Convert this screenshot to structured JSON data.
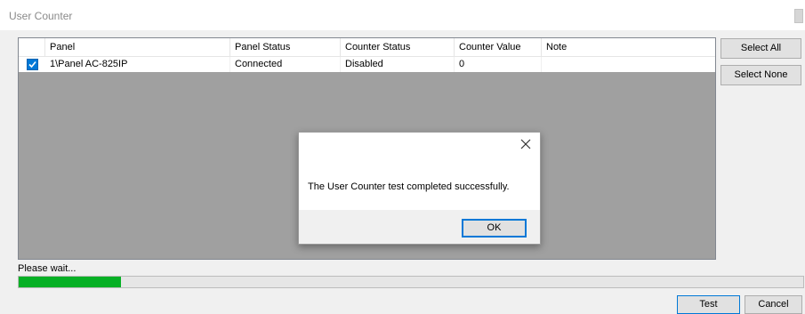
{
  "window": {
    "title": "User Counter"
  },
  "table": {
    "columns": [
      "Panel",
      "Panel Status",
      "Counter Status",
      "Counter Value",
      "Note"
    ],
    "rows": [
      {
        "checked": true,
        "cells": [
          "1\\Panel AC-825IP",
          "Connected",
          "Disabled",
          "0",
          ""
        ]
      }
    ]
  },
  "side_buttons": {
    "select_all": "Select All",
    "select_none": "Select None"
  },
  "status": {
    "text": "Please wait...",
    "progress": 0.13
  },
  "footer": {
    "test": "Test",
    "cancel": "Cancel"
  },
  "dialog": {
    "message": "The User Counter test completed successfully.",
    "ok": "OK"
  },
  "colors": {
    "accent": "#0078d7",
    "progress": "#06b025",
    "list_bg": "#a0a0a0"
  }
}
